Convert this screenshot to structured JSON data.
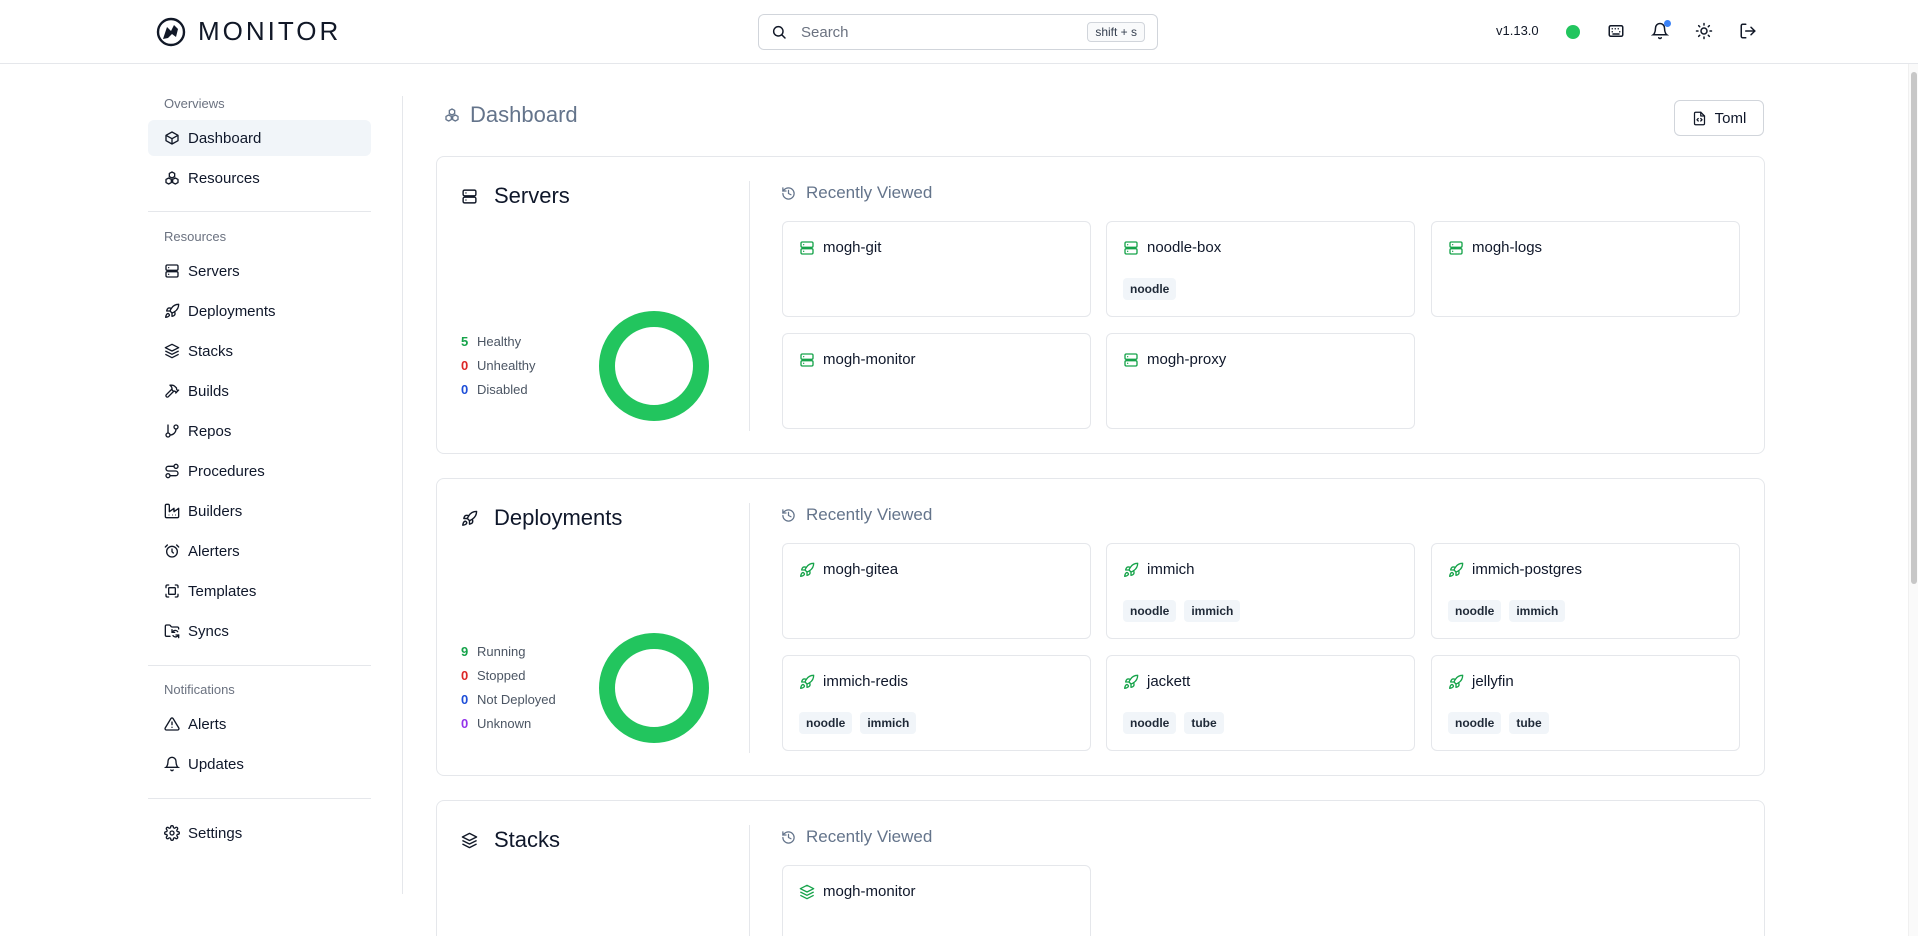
{
  "header": {
    "app_name": "MONITOR",
    "search_placeholder": "Search",
    "search_shortcut": "shift + s",
    "version": "v1.13.0"
  },
  "sidebar": {
    "overviews_title": "Overviews",
    "overviews": [
      {
        "label": "Dashboard",
        "icon": "box-icon",
        "active": true
      },
      {
        "label": "Resources",
        "icon": "boxes-icon"
      }
    ],
    "resources_title": "Resources",
    "resources": [
      {
        "label": "Servers",
        "icon": "server-icon"
      },
      {
        "label": "Deployments",
        "icon": "rocket-icon"
      },
      {
        "label": "Stacks",
        "icon": "layers-icon"
      },
      {
        "label": "Builds",
        "icon": "hammer-icon"
      },
      {
        "label": "Repos",
        "icon": "git-branch-icon"
      },
      {
        "label": "Procedures",
        "icon": "route-icon"
      },
      {
        "label": "Builders",
        "icon": "factory-icon"
      },
      {
        "label": "Alerters",
        "icon": "alarm-clock-icon"
      },
      {
        "label": "Templates",
        "icon": "template-icon"
      },
      {
        "label": "Syncs",
        "icon": "folder-sync-icon"
      }
    ],
    "notifications_title": "Notifications",
    "notifications": [
      {
        "label": "Alerts",
        "icon": "alert-triangle-icon"
      },
      {
        "label": "Updates",
        "icon": "bell-icon"
      }
    ],
    "settings_label": "Settings"
  },
  "main": {
    "title": "Dashboard",
    "toml_button": "Toml",
    "recently_viewed": "Recently Viewed",
    "sections": [
      {
        "title": "Servers",
        "icon": "server-icon",
        "stats": [
          {
            "count": "5",
            "label": "Healthy",
            "color": "#16a34a"
          },
          {
            "count": "0",
            "label": "Unhealthy",
            "color": "#dc2626"
          },
          {
            "count": "0",
            "label": "Disabled",
            "color": "#1d4ed8"
          }
        ],
        "donut_color": "#22c55e",
        "cards": [
          {
            "name": "mogh-git",
            "tags": []
          },
          {
            "name": "noodle-box",
            "tags": [
              "noodle"
            ]
          },
          {
            "name": "mogh-logs",
            "tags": []
          },
          {
            "name": "mogh-monitor",
            "tags": []
          },
          {
            "name": "mogh-proxy",
            "tags": []
          }
        ]
      },
      {
        "title": "Deployments",
        "icon": "rocket-icon",
        "stats": [
          {
            "count": "9",
            "label": "Running",
            "color": "#16a34a"
          },
          {
            "count": "0",
            "label": "Stopped",
            "color": "#dc2626"
          },
          {
            "count": "0",
            "label": "Not Deployed",
            "color": "#1d4ed8"
          },
          {
            "count": "0",
            "label": "Unknown",
            "color": "#9333ea"
          }
        ],
        "donut_color": "#22c55e",
        "cards": [
          {
            "name": "mogh-gitea",
            "tags": []
          },
          {
            "name": "immich",
            "tags": [
              "noodle",
              "immich"
            ]
          },
          {
            "name": "immich-postgres",
            "tags": [
              "noodle",
              "immich"
            ]
          },
          {
            "name": "immich-redis",
            "tags": [
              "noodle",
              "immich"
            ]
          },
          {
            "name": "jackett",
            "tags": [
              "noodle",
              "tube"
            ]
          },
          {
            "name": "jellyfin",
            "tags": [
              "noodle",
              "tube"
            ]
          }
        ]
      },
      {
        "title": "Stacks",
        "icon": "layers-icon",
        "stats": [],
        "cards": [
          {
            "name": "mogh-monitor",
            "tags": []
          }
        ]
      }
    ]
  },
  "colors": {
    "accent_green": "#22c55e",
    "icon_green": "#16a34a"
  }
}
